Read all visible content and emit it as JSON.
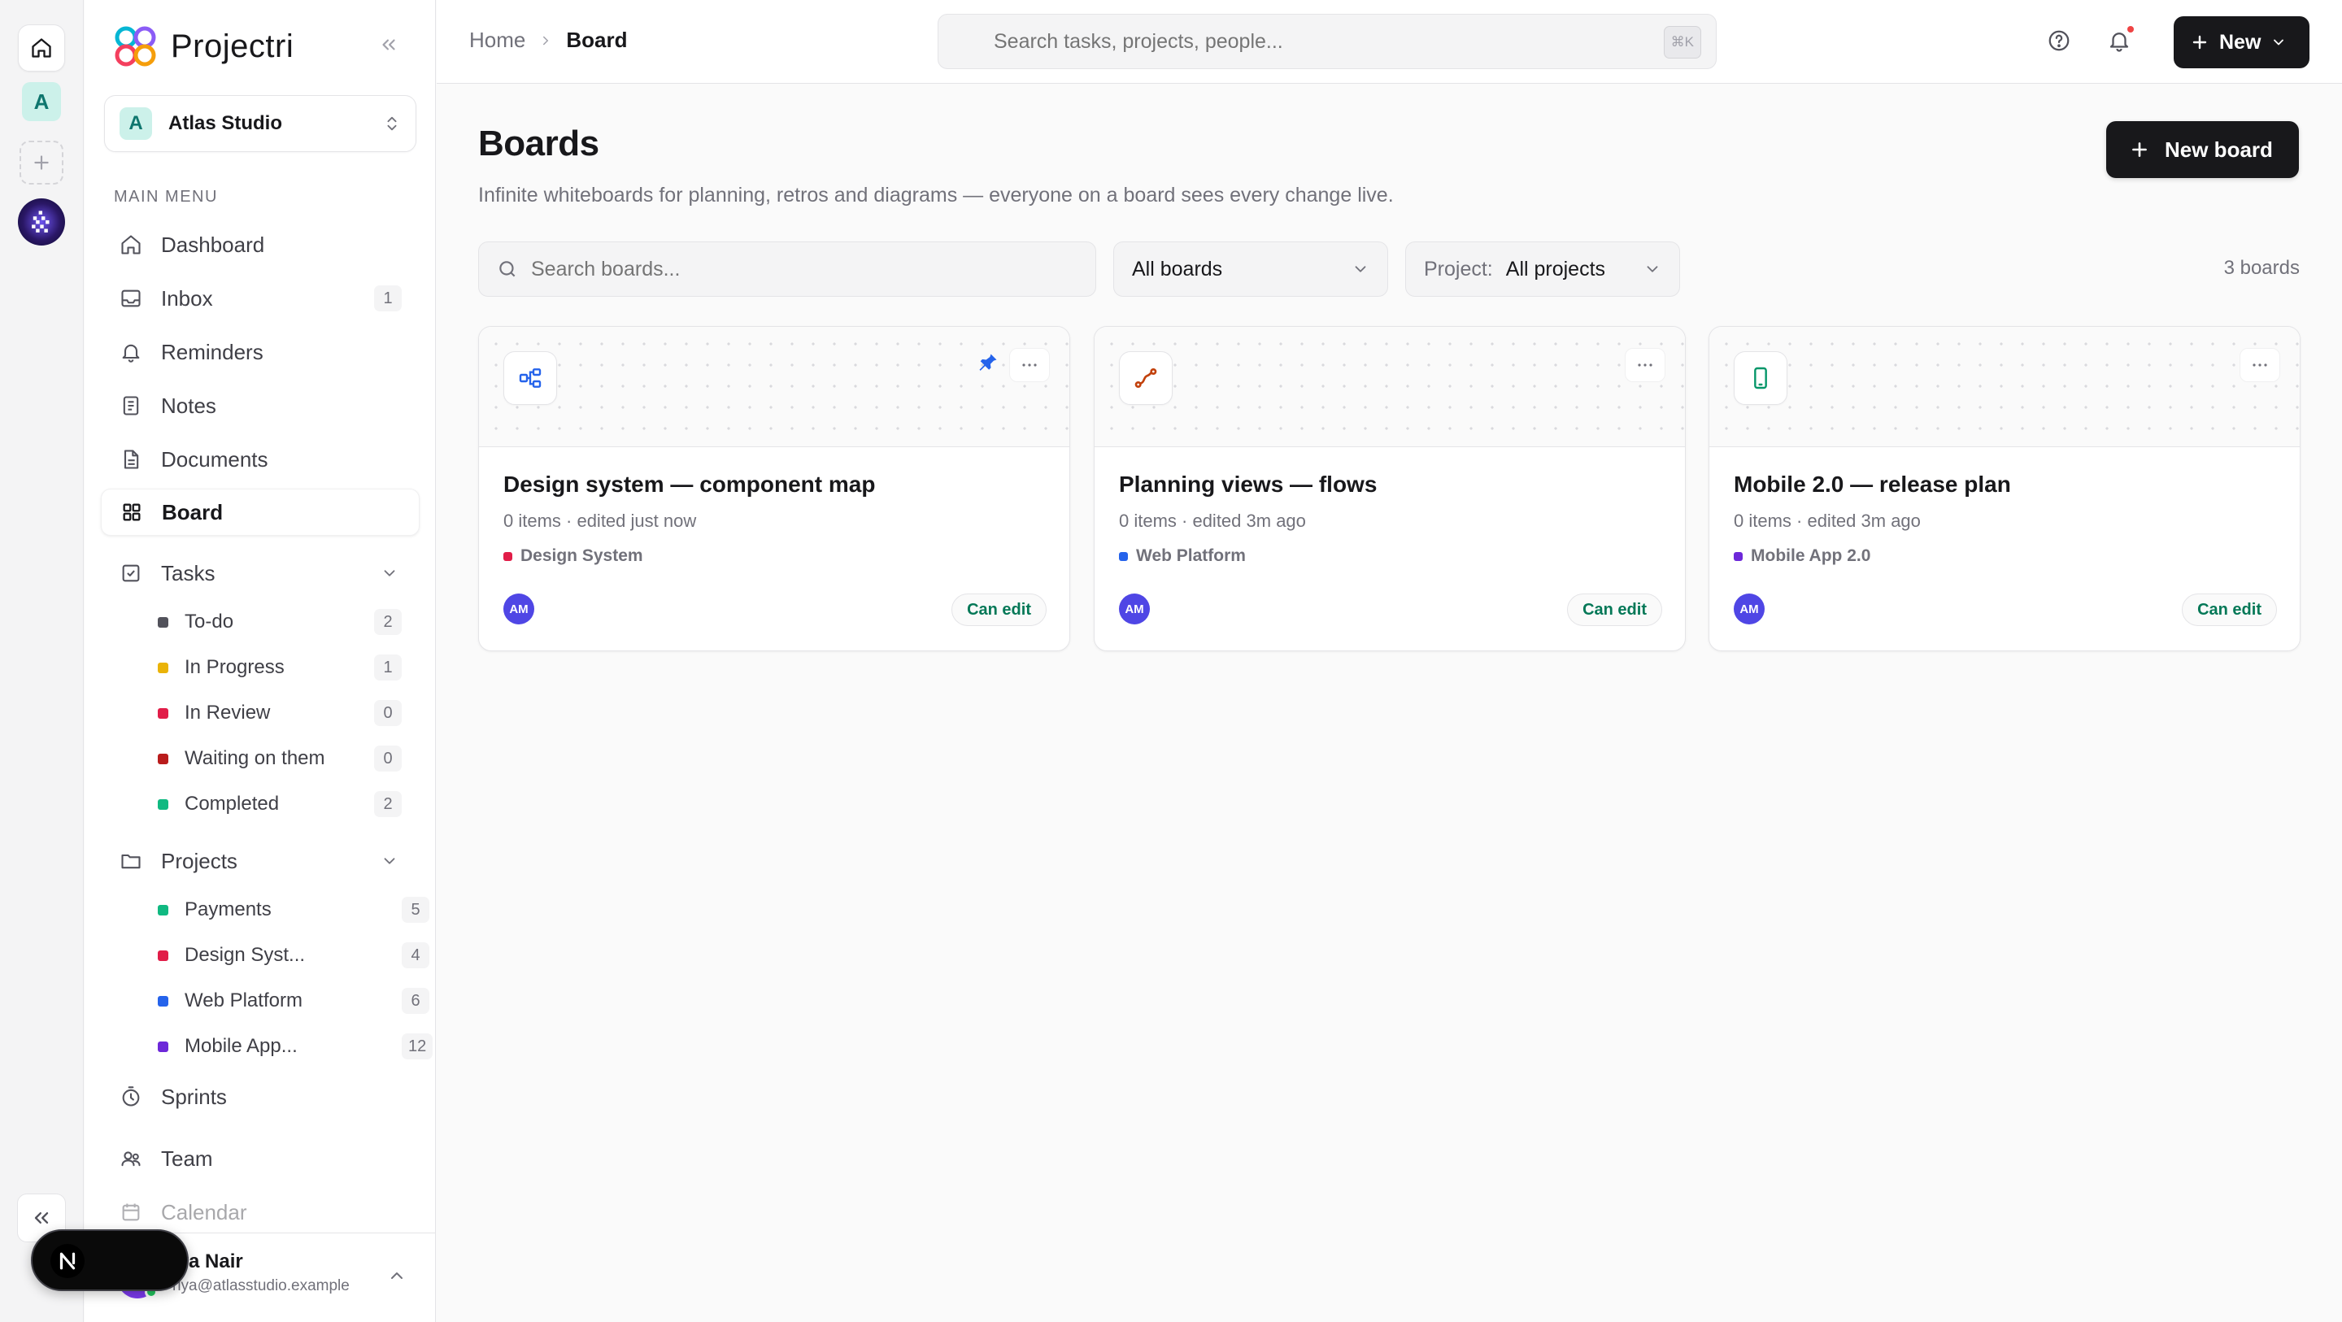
{
  "app": {
    "name": "Projectri"
  },
  "rail": {
    "workspace_initial": "A"
  },
  "workspace": {
    "initial": "A",
    "name": "Atlas Studio"
  },
  "sidebar": {
    "menu_label": "MAIN MENU",
    "items": [
      {
        "label": "Dashboard",
        "icon": "home-icon"
      },
      {
        "label": "Inbox",
        "icon": "inbox-icon",
        "count": "1"
      },
      {
        "label": "Reminders",
        "icon": "bell-icon"
      },
      {
        "label": "Notes",
        "icon": "note-icon"
      },
      {
        "label": "Documents",
        "icon": "document-icon"
      },
      {
        "label": "Board",
        "icon": "grid-icon",
        "active": true
      },
      {
        "label": "Tasks",
        "icon": "checkbox-icon"
      },
      {
        "label": "Projects",
        "icon": "folder-icon"
      },
      {
        "label": "Sprints",
        "icon": "timer-icon"
      },
      {
        "label": "Team",
        "icon": "team-icon"
      },
      {
        "label": "Calendar",
        "icon": "calendar-icon"
      }
    ],
    "tasks": [
      {
        "label": "To-do",
        "count": "2",
        "color": "#52525b"
      },
      {
        "label": "In Progress",
        "count": "1",
        "color": "#eab308"
      },
      {
        "label": "In Review",
        "count": "0",
        "color": "#e11d48"
      },
      {
        "label": "Waiting on them",
        "count": "0",
        "color": "#b91c1c"
      },
      {
        "label": "Completed",
        "count": "2",
        "color": "#10b981"
      }
    ],
    "projects": [
      {
        "label": "Payments",
        "count": "5",
        "color": "#10b981"
      },
      {
        "label": "Design Syst...",
        "count": "4",
        "color": "#e11d48"
      },
      {
        "label": "Web Platform",
        "count": "6",
        "color": "#2563eb"
      },
      {
        "label": "Mobile App...",
        "count": "12",
        "color": "#6d28d9"
      }
    ]
  },
  "user": {
    "name": "iya Nair",
    "email": "riya@atlasstudio.example"
  },
  "topbar": {
    "breadcrumb": {
      "home": "Home",
      "current": "Board"
    },
    "search_placeholder": "Search tasks, projects, people...",
    "shortcut": "⌘K",
    "new_label": "New"
  },
  "page": {
    "title": "Boards",
    "subtitle": "Infinite whiteboards for planning, retros and diagrams — everyone on a board sees every change live.",
    "new_board_label": "New board",
    "search_placeholder": "Search boards...",
    "filter_boards": "All boards",
    "filter_project_prefix": "Project:",
    "filter_project": "All projects",
    "count_label": "3 boards"
  },
  "boards": [
    {
      "title": "Design system — component map",
      "meta": "0 items · edited just now",
      "project": "Design System",
      "project_color": "#e11d48",
      "icon": "diagram-icon",
      "pinned": true,
      "avatar": "AM",
      "permission": "Can edit"
    },
    {
      "title": "Planning views — flows",
      "meta": "0 items · edited 3m ago",
      "project": "Web Platform",
      "project_color": "#2563eb",
      "icon": "flow-icon",
      "pinned": false,
      "avatar": "AM",
      "permission": "Can edit"
    },
    {
      "title": "Mobile 2.0 — release plan",
      "meta": "0 items · edited 3m ago",
      "project": "Mobile App 2.0",
      "project_color": "#6d28d9",
      "icon": "mobile-icon",
      "pinned": false,
      "avatar": "AM",
      "permission": "Can edit"
    }
  ],
  "colors": {
    "accent": "#18181b",
    "success": "#047857",
    "teal": "#0f766e"
  }
}
